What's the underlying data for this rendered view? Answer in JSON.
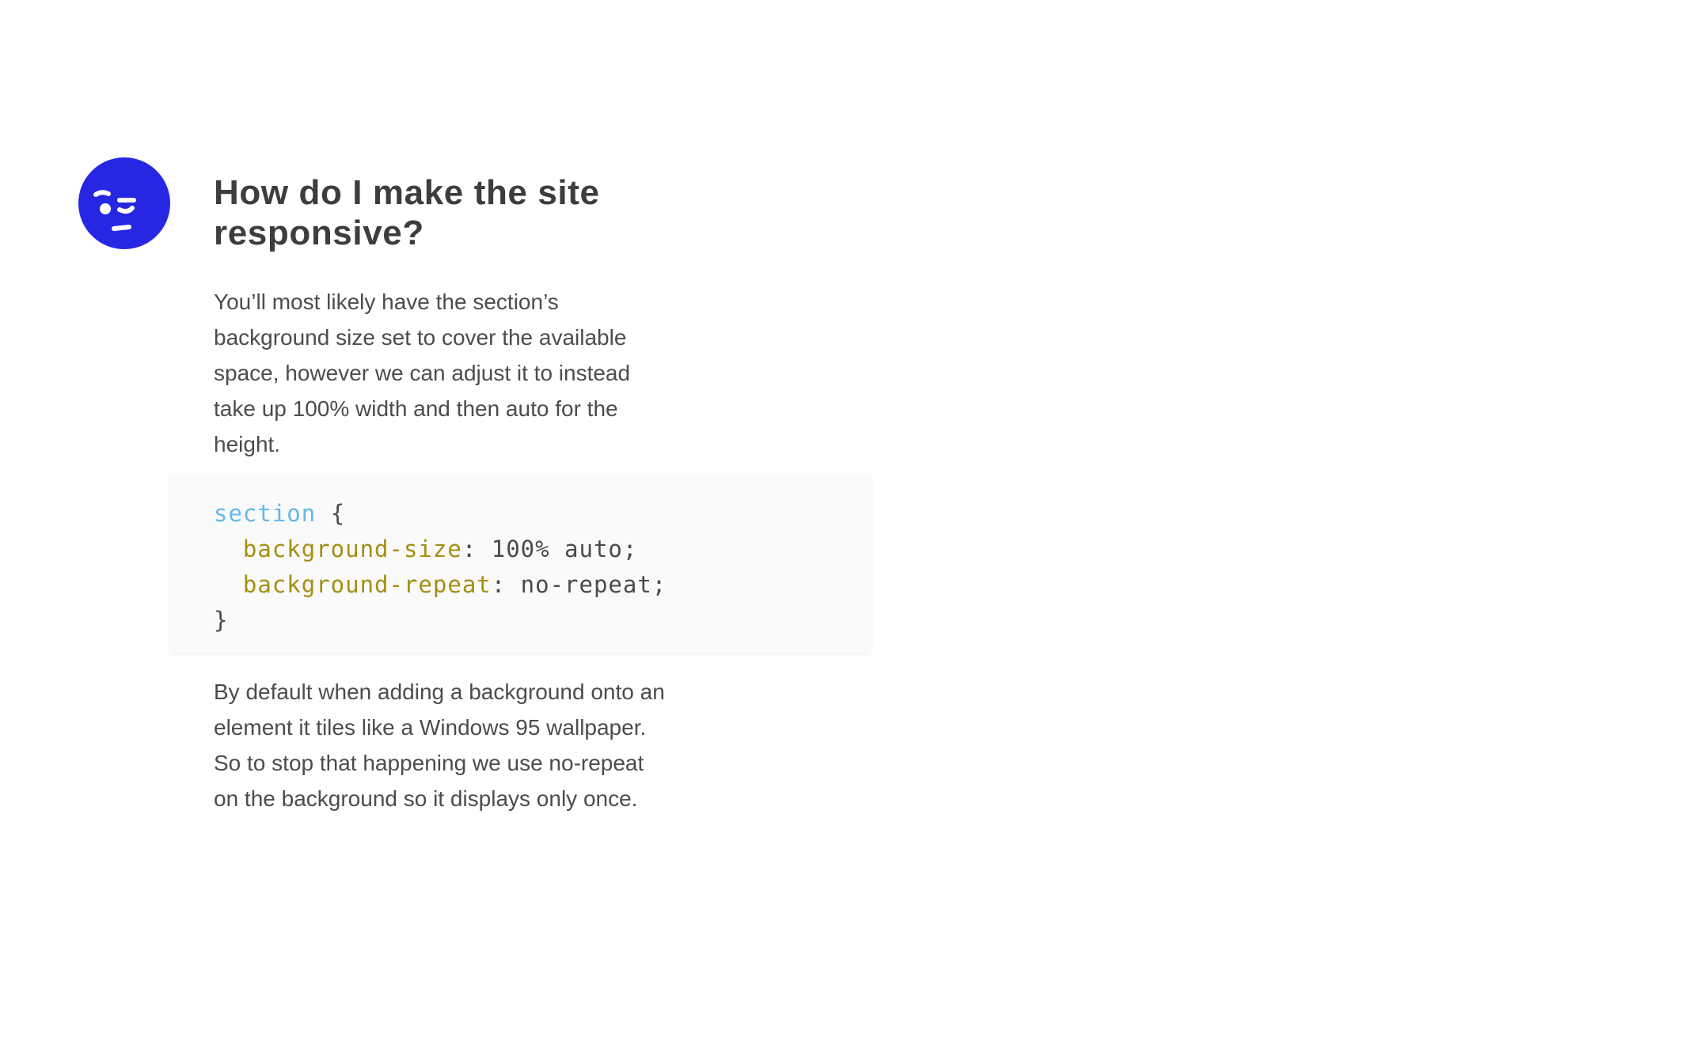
{
  "article": {
    "heading": "How do I make the site responsive?",
    "paragraph_1": "You’ll most likely have the section’s background size set to cover the available space, however we can adjust it to instead take up 100% width and then auto for the height.",
    "paragraph_2": "By default when adding a background onto an element it tiles like a Windows 95 wallpaper. So to stop that happening we use no-repeat on the background so it displays only once."
  },
  "code": {
    "selector": "section",
    "open_brace": "{",
    "lines": [
      {
        "property": "background-size",
        "value": "100% auto"
      },
      {
        "property": "background-repeat",
        "value": "no-repeat"
      }
    ],
    "close_brace": "}"
  },
  "avatar": {
    "icon": "winking-face-icon",
    "color": "#2727e3"
  },
  "colors": {
    "selector": "#66b8e8",
    "property": "#a38f12",
    "text": "#4a4a4a"
  }
}
